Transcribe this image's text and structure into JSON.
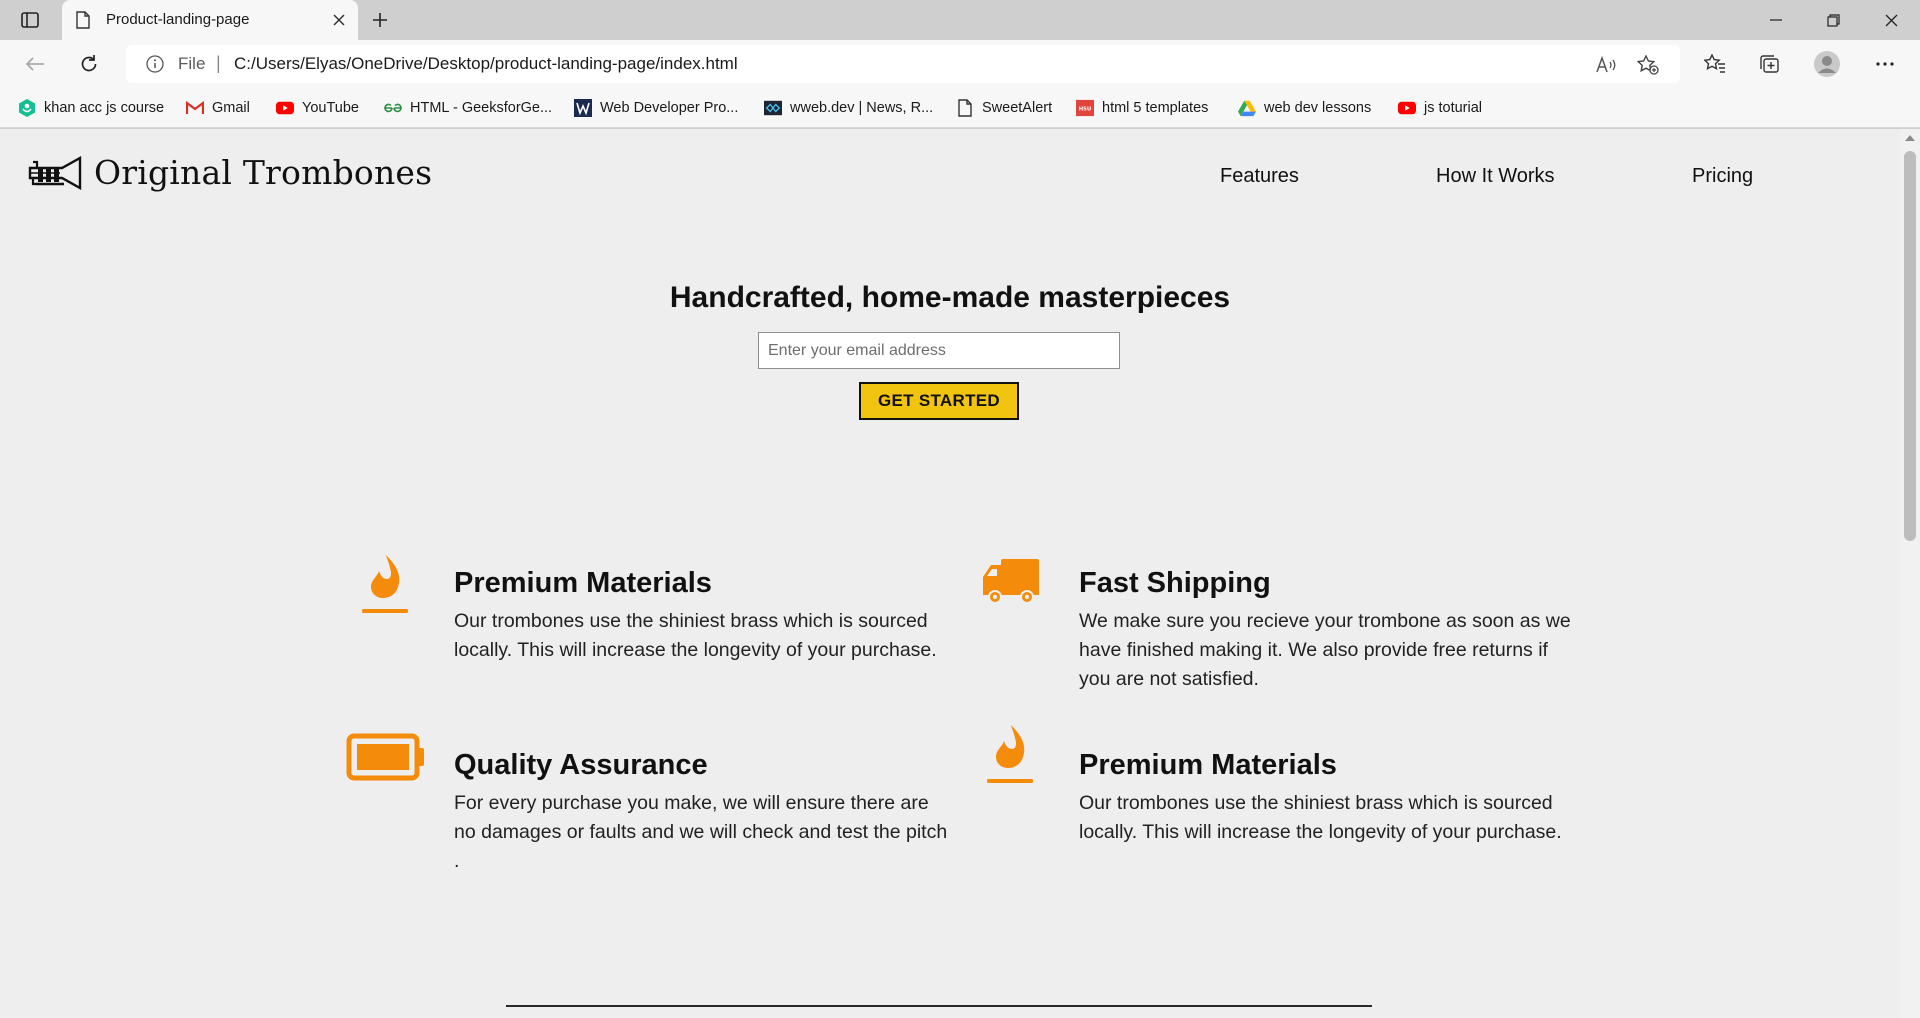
{
  "browser": {
    "tab_title": "Product-landing-page",
    "address_scheme": "File",
    "address_url": "C:/Users/Elyas/OneDrive/Desktop/product-landing-page/index.html",
    "bookmarks": [
      {
        "label": "khan acc js course",
        "icon": "khan-academy-icon"
      },
      {
        "label": "Gmail",
        "icon": "gmail-icon"
      },
      {
        "label": "YouTube",
        "icon": "youtube-icon"
      },
      {
        "label": "HTML - GeeksforGe...",
        "icon": "geeksforgeeks-icon"
      },
      {
        "label": "Web Developer Pro...",
        "icon": "web-developer-icon"
      },
      {
        "label": "wweb.dev | News, R...",
        "icon": "wweb-dev-icon"
      },
      {
        "label": "SweetAlert",
        "icon": "document-icon"
      },
      {
        "label": "html 5 templates",
        "icon": "html5-templates-icon"
      },
      {
        "label": "web dev lessons",
        "icon": "google-drive-icon"
      },
      {
        "label": "js toturial",
        "icon": "youtube-icon"
      }
    ]
  },
  "page": {
    "brand": "Original Trombones",
    "nav": [
      "Features",
      "How It Works",
      "Pricing"
    ],
    "hero_title": "Handcrafted, home-made masterpieces",
    "email_placeholder": "Enter your email address",
    "cta_label": "GET STARTED",
    "features": [
      {
        "icon": "fire-icon",
        "title": "Premium Materials",
        "text": "Our trombones use the shiniest brass which is sourced locally. This will increase the longevity of your purchase."
      },
      {
        "icon": "truck-icon",
        "title": "Fast Shipping",
        "text": "We make sure you recieve your trombone as soon as we have finished making it. We also provide free returns if you are not satisfied."
      },
      {
        "icon": "battery-full-icon",
        "title": "Quality Assurance",
        "text": "For every purchase you make, we will ensure there are no damages or faults and we will check and test the pitch ."
      },
      {
        "icon": "fire-icon",
        "title": "Premium Materials",
        "text": "Our trombones use the shiniest brass which is sourced locally. This will increase the longevity of your purchase."
      }
    ]
  },
  "colors": {
    "accent_orange": "#f58b0a",
    "cta_yellow": "#f1c40f",
    "page_background": "#eeeeee"
  }
}
